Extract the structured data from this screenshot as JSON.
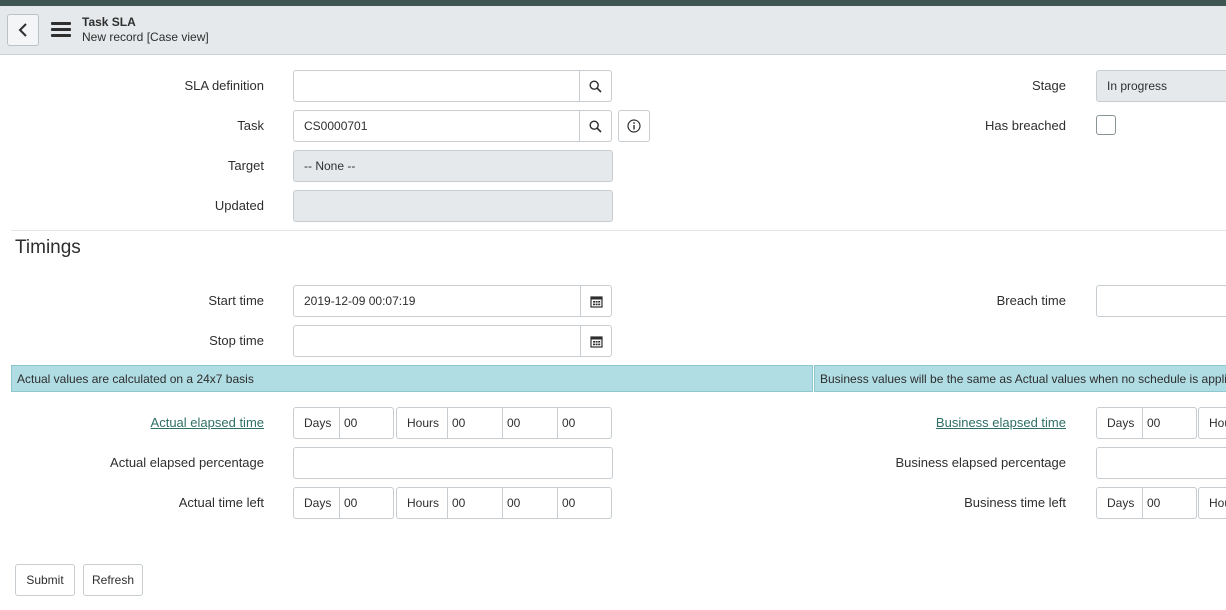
{
  "header": {
    "title": "Task SLA",
    "subtitle": "New record [Case view]"
  },
  "fields": {
    "sla_definition": {
      "label": "SLA definition",
      "value": ""
    },
    "task": {
      "label": "Task",
      "value": "CS0000701"
    },
    "target": {
      "label": "Target",
      "value": "-- None --"
    },
    "updated": {
      "label": "Updated",
      "value": ""
    },
    "stage": {
      "label": "Stage",
      "value": "In progress"
    },
    "has_breached": {
      "label": "Has breached"
    }
  },
  "timings": {
    "title": "Timings",
    "start_time": {
      "label": "Start time",
      "value": "2019-12-09 00:07:19"
    },
    "stop_time": {
      "label": "Stop time",
      "value": ""
    },
    "breach_time": {
      "label": "Breach time",
      "value": ""
    },
    "actual_info": "Actual values are calculated on a 24x7 basis",
    "business_info": "Business values will be the same as Actual values when no schedule is applied",
    "actual_elapsed_time": {
      "label": "Actual elapsed time",
      "days_label": "Days",
      "days": "00",
      "hours_label": "Hours",
      "hours": "00",
      "minutes": "00",
      "seconds": "00"
    },
    "actual_elapsed_percentage": {
      "label": "Actual elapsed percentage",
      "value": ""
    },
    "actual_time_left": {
      "label": "Actual time left",
      "days_label": "Days",
      "days": "00",
      "hours_label": "Hours",
      "hours": "00",
      "minutes": "00",
      "seconds": "00"
    },
    "business_elapsed_time": {
      "label": "Business elapsed time",
      "days_label": "Days",
      "days": "00",
      "hours_label": "Hou"
    },
    "business_elapsed_percentage": {
      "label": "Business elapsed percentage",
      "value": ""
    },
    "business_time_left": {
      "label": "Business time left",
      "days_label": "Days",
      "days": "00",
      "hours_label": "Hou"
    }
  },
  "actions": {
    "submit": "Submit",
    "refresh": "Refresh"
  }
}
